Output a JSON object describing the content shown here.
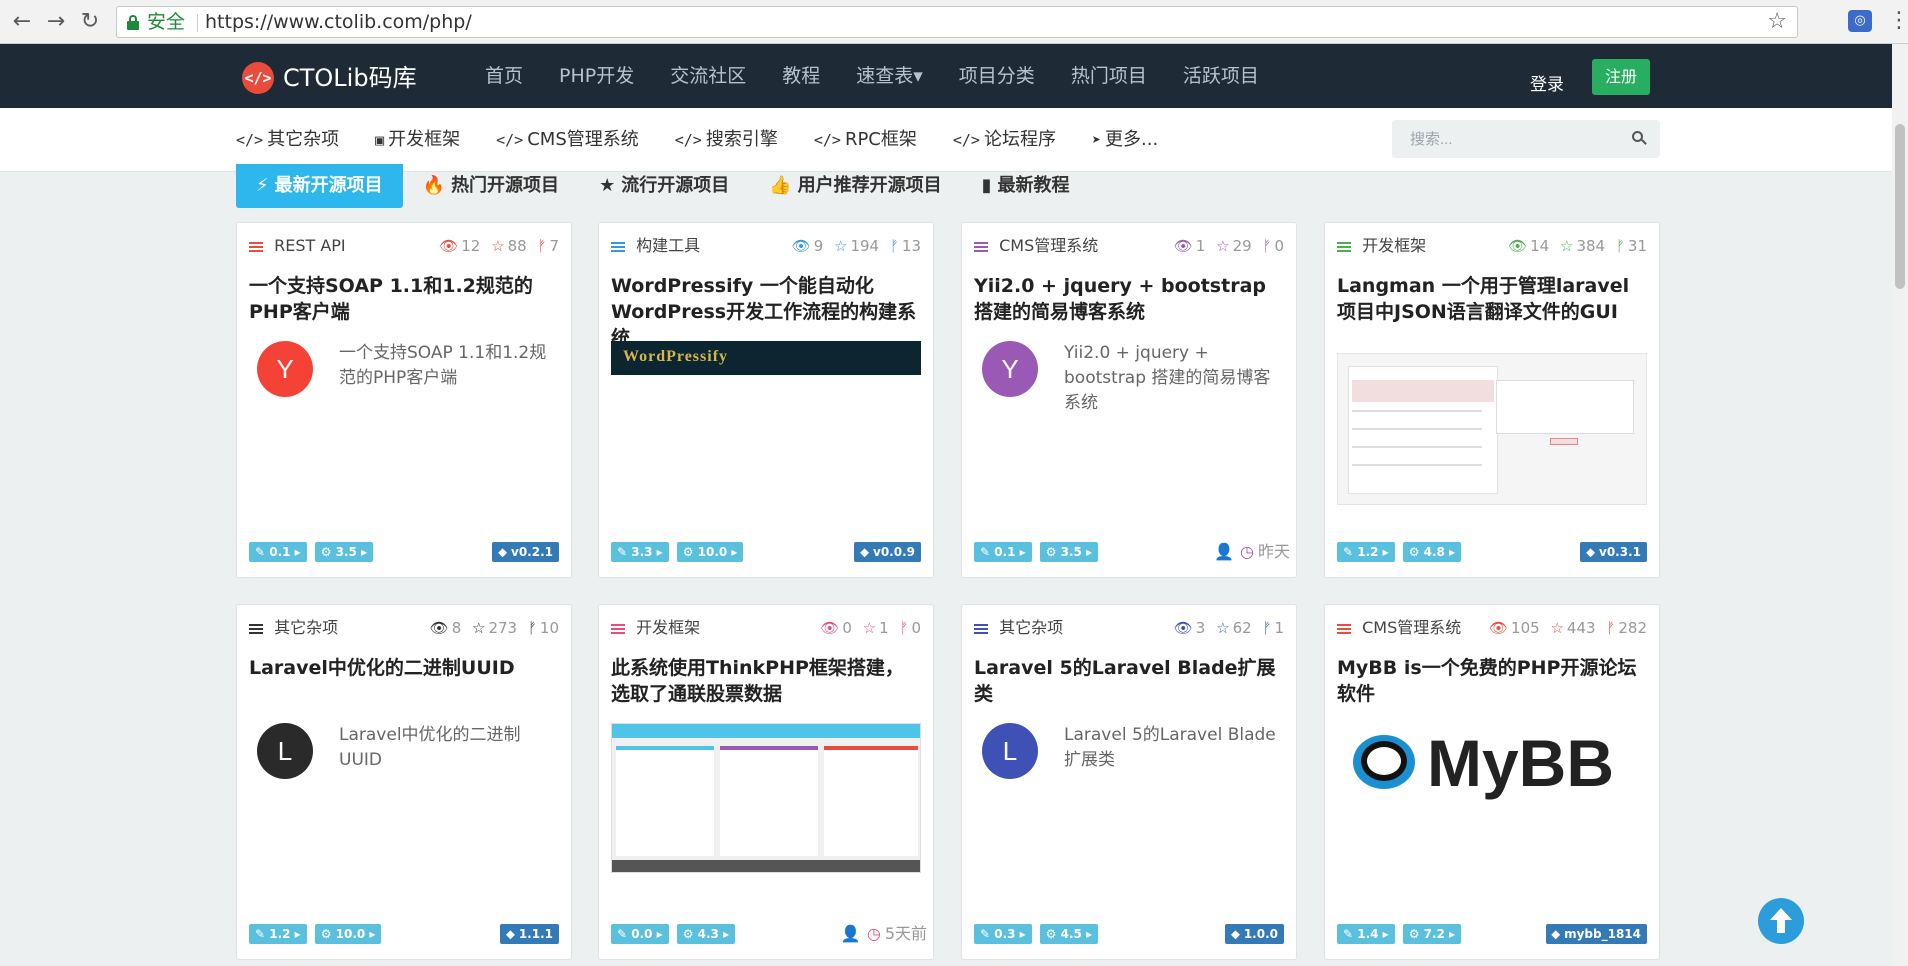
{
  "browser": {
    "secure_label": "安全",
    "url": "https://www.ctolib.com/php/"
  },
  "site": {
    "logo_glyph": "</>",
    "name": "CTOLib码库",
    "nav": [
      "首页",
      "PHP开发",
      "交流社区",
      "教程",
      "速查表▾",
      "项目分类",
      "热门项目",
      "活跃项目"
    ],
    "login": "登录",
    "register": "注册"
  },
  "subnav": {
    "items": [
      {
        "icon": "</>",
        "label": "其它杂项"
      },
      {
        "icon": "▣",
        "label": "开发框架"
      },
      {
        "icon": "</>",
        "label": "CMS管理系统"
      },
      {
        "icon": "</>",
        "label": "搜索引擎"
      },
      {
        "icon": "</>",
        "label": "RPC框架"
      },
      {
        "icon": "</>",
        "label": "论坛程序"
      },
      {
        "icon": "➤",
        "label": "更多..."
      }
    ],
    "search_placeholder": "搜索..."
  },
  "tabs": [
    {
      "icon": "⚡",
      "label": "最新开源项目"
    },
    {
      "icon": "🔥",
      "label": "热门开源项目"
    },
    {
      "icon": "★",
      "label": "流行开源项目"
    },
    {
      "icon": "👍",
      "label": "用户推荐开源项目"
    },
    {
      "icon": "▮",
      "label": "最新教程"
    }
  ],
  "cards": [
    {
      "category": "REST API",
      "color": "#e74c3c",
      "views": "12",
      "stars": "88",
      "forks": "7",
      "title": "一个支持SOAP 1.1和1.2规范的PHP客户端",
      "avatar": "Y",
      "desc": "一个支持SOAP 1.1和1.2规范的PHP客户端",
      "badge1": "0.1",
      "badge2": "3.5",
      "version": "v0.2.1"
    },
    {
      "category": "构建工具",
      "color": "#3498db",
      "views": "9",
      "stars": "194",
      "forks": "13",
      "title": "WordPressify 一个能自动化WordPress开发工作流程的构建系统",
      "thumb_text": "WordPressify",
      "badge1": "3.3",
      "badge2": "10.0",
      "version": "v0.0.9"
    },
    {
      "category": "CMS管理系统",
      "color": "#9b59b6",
      "views": "1",
      "stars": "29",
      "forks": "0",
      "title": "Yii2.0 + jquery + bootstrap 搭建的简易博客系统",
      "avatar": "Y",
      "desc": "Yii2.0 + jquery + bootstrap 搭建的简易博客系统",
      "badge1": "0.1",
      "badge2": "3.5",
      "meta": "昨天"
    },
    {
      "category": "开发框架",
      "color": "#4cae4c",
      "views": "14",
      "stars": "384",
      "forks": "31",
      "title": "Langman 一个用于管理laravel项目中JSON语言翻译文件的GUI",
      "badge1": "1.2",
      "badge2": "4.8",
      "version": "v0.3.1"
    },
    {
      "category": "其它杂项",
      "color": "#333333",
      "views": "8",
      "stars": "273",
      "forks": "10",
      "title": "Laravel中优化的二进制UUID",
      "avatar": "L",
      "desc": "Laravel中优化的二进制UUID",
      "badge1": "1.2",
      "badge2": "10.0",
      "version": "1.1.1"
    },
    {
      "category": "开发框架",
      "color": "#e84c7e",
      "views": "0",
      "stars": "1",
      "forks": "0",
      "title": "此系统使用ThinkPHP框架搭建，选取了通联股票数据",
      "badge1": "0.0",
      "badge2": "4.3",
      "meta": "5天前"
    },
    {
      "category": "其它杂项",
      "color": "#3f51b5",
      "views": "3",
      "stars": "62",
      "forks": "1",
      "title": "Laravel 5的Laravel Blade扩展类",
      "avatar": "L",
      "desc": "Laravel 5的Laravel Blade扩展类",
      "badge1": "0.3",
      "badge2": "4.5",
      "version": "1.0.0"
    },
    {
      "category": "CMS管理系统",
      "color": "#e74c3c",
      "views": "105",
      "stars": "443",
      "forks": "282",
      "title": "MyBB is一个免费的PHP开源论坛软件",
      "thumb_text": "MyBB",
      "badge1": "1.4",
      "badge2": "7.2",
      "version": "mybb_1814"
    }
  ]
}
